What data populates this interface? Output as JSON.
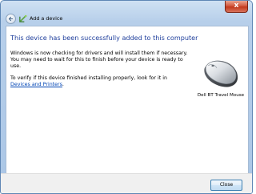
{
  "window": {
    "title": "Add a device",
    "close_glyph": "x"
  },
  "content": {
    "heading": "This device has been successfully added to this computer",
    "paragraph1": "Windows is now checking for drivers and will install them if necessary. You may need to wait for this to finish before your device is ready to use.",
    "paragraph2_text": "To verify if this device finished installing properly, look for it in",
    "paragraph2_link": "Devices and Printers",
    "paragraph2_end": "."
  },
  "device": {
    "name": "Dell BT Travel Mouse",
    "icon": "mouse-icon"
  },
  "footer": {
    "close_button_label": "Close"
  },
  "icons": {
    "back": "back-arrow-icon",
    "wizard": "add-device-icon"
  },
  "colors": {
    "heading": "#1f3f9c",
    "link": "#0044b4",
    "close_red": "#c2391c",
    "frame": "#aac6e6"
  }
}
